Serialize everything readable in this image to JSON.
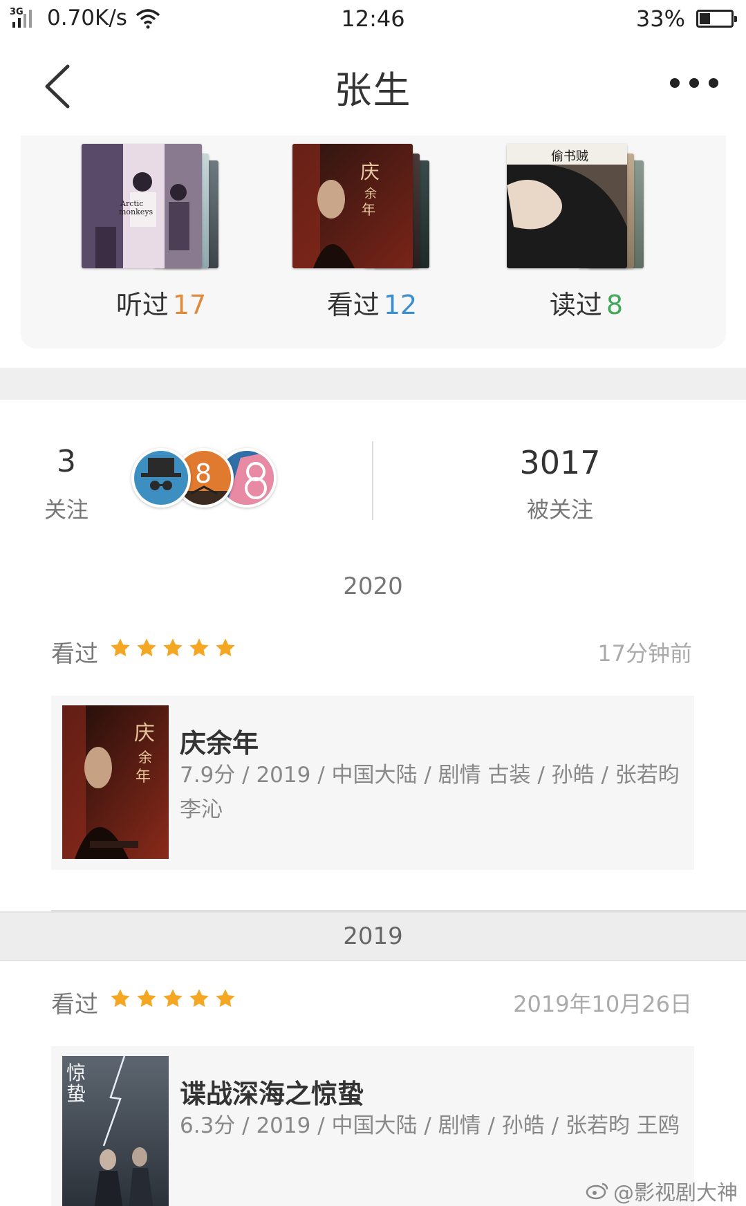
{
  "status_bar": {
    "network": "3G",
    "speed": "0.70K/s",
    "time": "12:46",
    "battery_text": "33%",
    "battery_level": 0.33
  },
  "nav": {
    "title": "张生"
  },
  "collections": [
    {
      "label": "听过",
      "count": "17",
      "count_color": "#e0893a"
    },
    {
      "label": "看过",
      "count": "12",
      "count_color": "#3b8fd0"
    },
    {
      "label": "读过",
      "count": "8",
      "count_color": "#42a85a"
    }
  ],
  "follow": {
    "following_count": "3",
    "following_label": "关注",
    "followers_count": "3017",
    "followers_label": "被关注"
  },
  "timeline": {
    "year_2020": "2020",
    "year_2019": "2019",
    "entries": [
      {
        "action": "看过",
        "rating": 5,
        "time": "17分钟前",
        "title": "庆余年",
        "meta": "7.9分 / 2019 / 中国大陆 / 剧情 古装 / 孙皓 / 张若昀 李沁"
      },
      {
        "action": "看过",
        "rating": 5,
        "time": "2019年10月26日",
        "title": "谍战深海之惊蛰",
        "meta": "6.3分 / 2019 / 中国大陆 / 剧情 / 孙皓 / 张若昀 王鸥"
      }
    ]
  },
  "watermark": "@影视剧大神",
  "colors": {
    "star": "#f5a623",
    "accent_listen": "#e0893a",
    "accent_watch": "#3b8fd0",
    "accent_read": "#42a85a"
  }
}
